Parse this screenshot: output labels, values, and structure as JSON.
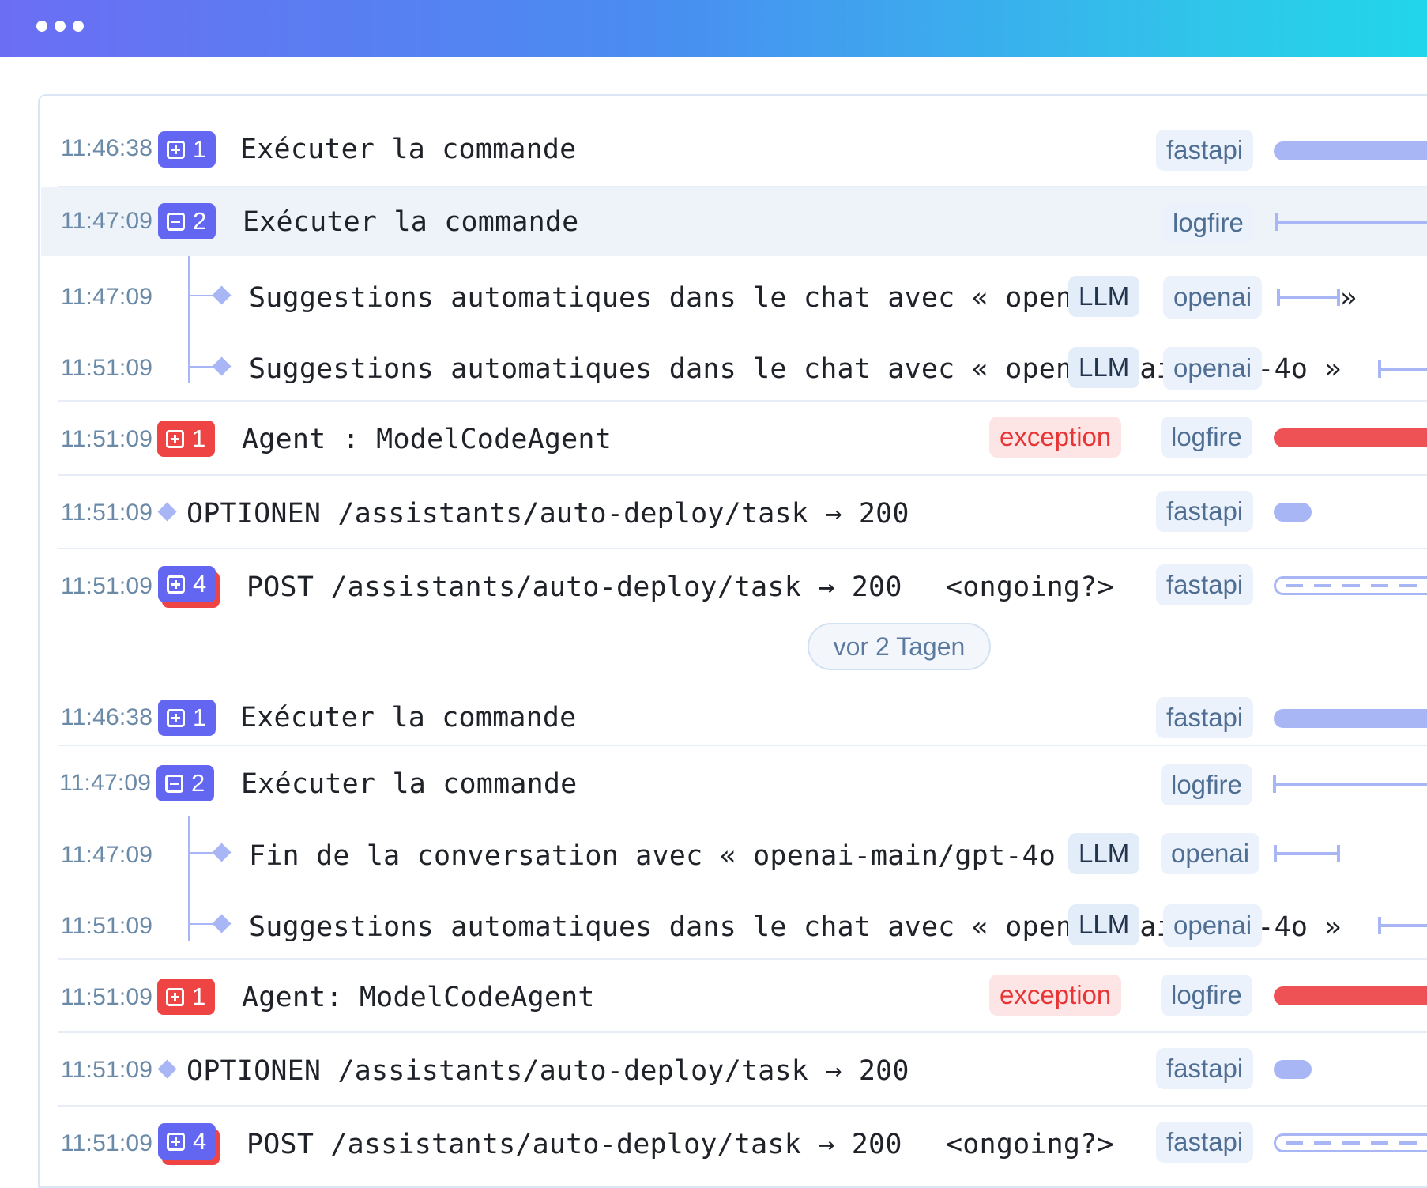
{
  "window": {
    "controls": [
      "dot",
      "dot",
      "dot"
    ]
  },
  "divider": {
    "label": "vor 2 Tagen"
  },
  "rows": [
    {
      "time": "11:46:38",
      "badge_count": "1",
      "title": "Exécuter la commande",
      "service": "fastapi"
    },
    {
      "time": "11:47:09",
      "badge_count": "2",
      "title": "Exécuter la commande",
      "service": "logfire"
    },
    {
      "time": "11:47:09",
      "title": "Suggestions automatiques dans le chat avec « openai-main/gpt-4o »",
      "llm": "LLM",
      "service": "openai"
    },
    {
      "time": "11:51:09",
      "title": "Suggestions automatiques dans le chat avec « openai-main/gpt-4o »",
      "llm": "LLM",
      "service": "openai"
    },
    {
      "time": "11:51:09",
      "badge_count": "1",
      "title": "Agent : ModelCodeAgent",
      "status": "exception",
      "service": "logfire"
    },
    {
      "time": "11:51:09",
      "title": "OPTIONEN /assistants/auto-deploy/task → 200",
      "service": "fastapi"
    },
    {
      "time": "11:51:09",
      "badge_count": "4",
      "title": "POST /assistants/auto-deploy/task → 200",
      "state": "<ongoing?>",
      "service": "fastapi"
    },
    {
      "time": "11:46:38",
      "badge_count": "1",
      "title": "Exécuter la commande",
      "service": "fastapi"
    },
    {
      "time": "11:47:09",
      "badge_count": "2",
      "title": "Exécuter la commande",
      "service": "logfire"
    },
    {
      "time": "11:47:09",
      "title": "Fin de la conversation avec « openai-main/gpt-4o",
      "llm": "LLM",
      "service": "openai"
    },
    {
      "time": "11:51:09",
      "title": "Suggestions automatiques dans le chat avec « openai-main/gpt-4o »",
      "llm": "LLM",
      "service": "openai"
    },
    {
      "time": "11:51:09",
      "badge_count": "1",
      "title": "Agent: ModelCodeAgent",
      "status": "exception",
      "service": "logfire"
    },
    {
      "time": "11:51:09",
      "title": "OPTIONEN /assistants/auto-deploy/task → 200",
      "service": "fastapi"
    },
    {
      "time": "11:51:09",
      "badge_count": "4",
      "title": "POST /assistants/auto-deploy/task → 200",
      "state": "<ongoing?>",
      "service": "fastapi"
    }
  ],
  "colors": {
    "accent": "#6366f1",
    "error": "#ef4444",
    "bar": "#a9b6f5"
  }
}
